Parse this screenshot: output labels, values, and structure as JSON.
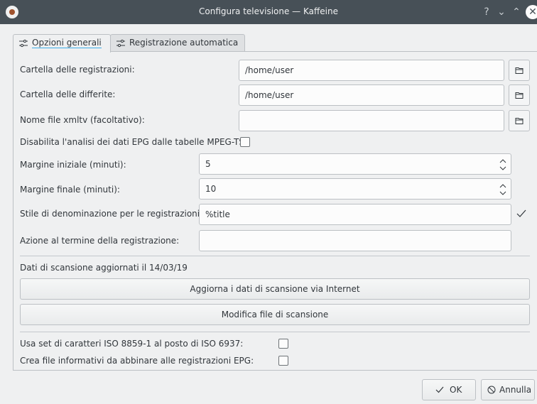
{
  "window": {
    "title": "Configura televisione — Kaffeine"
  },
  "titlebar": {
    "help": "?",
    "minimize": "⌄",
    "maximize": "⌃",
    "close": "✕"
  },
  "tabs": [
    {
      "label": "Opzioni generali",
      "active": true
    },
    {
      "label": "Registrazione automatica",
      "active": false
    }
  ],
  "form": {
    "recordings_folder": {
      "label": "Cartella delle registrazioni:",
      "value": "/home/user"
    },
    "timeshift_folder": {
      "label": "Cartella delle differite:",
      "value": "/home/user"
    },
    "xmltv_file": {
      "label": "Nome file xmltv (facoltativo):",
      "value": ""
    },
    "disable_epg": {
      "label": "Disabilita l'analisi dei dati EPG dalle tabelle MPEG-TS:",
      "checked": false
    },
    "start_margin": {
      "label": "Margine iniziale (minuti):",
      "value": "5"
    },
    "end_margin": {
      "label": "Margine finale (minuti):",
      "value": "10"
    },
    "naming_style": {
      "label": "Stile di denominazione per le registrazioni:",
      "value": "%title"
    },
    "end_action": {
      "label": "Azione al termine della registrazione:",
      "value": ""
    }
  },
  "scan": {
    "status": "Dati di scansione aggiornati il 14/03/19",
    "update_button": "Aggiorna i dati di scansione via Internet",
    "edit_button": "Modifica file di scansione"
  },
  "options": {
    "iso_charset": {
      "label": "Usa set di caratteri ISO 8859-1 al posto di ISO 6937:",
      "checked": false
    },
    "epg_info_files": {
      "label": "Crea file informativi da abbinare alle registrazioni EPG:",
      "checked": false
    }
  },
  "buttons": {
    "ok": "OK",
    "cancel": "Annulla"
  },
  "colors": {
    "titlebar": "#475057",
    "accent": "#3daee9",
    "background": "#eff0f1"
  }
}
